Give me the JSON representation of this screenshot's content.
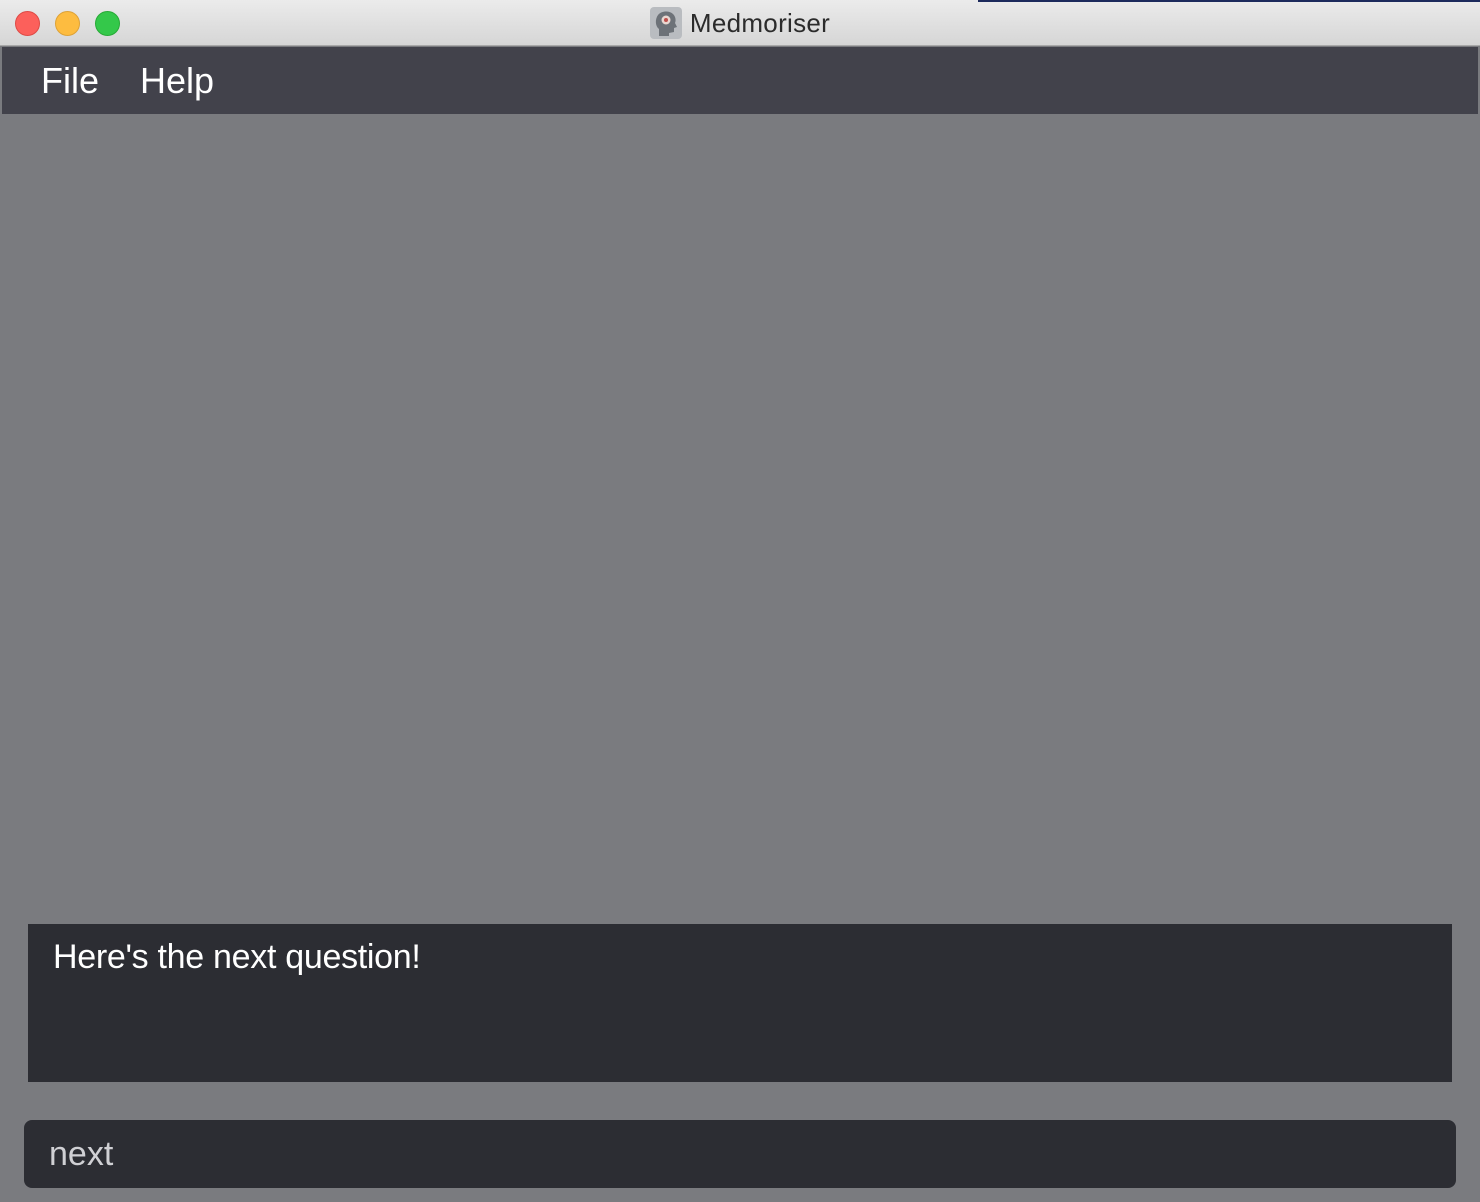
{
  "window": {
    "title": "Medmoriser",
    "app_icon": "head-icon"
  },
  "menubar": {
    "items": [
      {
        "label": "File"
      },
      {
        "label": "Help"
      }
    ]
  },
  "result_display": {
    "message": "Here's the next question!"
  },
  "command_box": {
    "value": "next",
    "placeholder": ""
  },
  "colors": {
    "menubar_bg": "#42424b",
    "content_bg": "#7a7b7f",
    "panel_bg": "#2c2d33",
    "close": "#fc605b",
    "minimize": "#fdbc40",
    "maximize": "#34c84a"
  }
}
